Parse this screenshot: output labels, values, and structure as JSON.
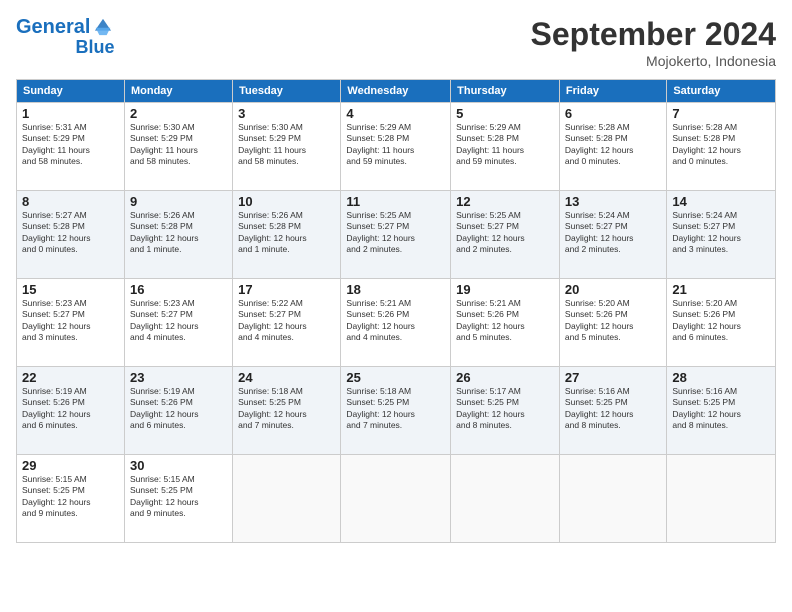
{
  "header": {
    "logo_line1": "General",
    "logo_line2": "Blue",
    "title": "September 2024",
    "location": "Mojokerto, Indonesia"
  },
  "weekdays": [
    "Sunday",
    "Monday",
    "Tuesday",
    "Wednesday",
    "Thursday",
    "Friday",
    "Saturday"
  ],
  "weeks": [
    [
      {
        "day": "1",
        "info": "Sunrise: 5:31 AM\nSunset: 5:29 PM\nDaylight: 11 hours\nand 58 minutes."
      },
      {
        "day": "2",
        "info": "Sunrise: 5:30 AM\nSunset: 5:29 PM\nDaylight: 11 hours\nand 58 minutes."
      },
      {
        "day": "3",
        "info": "Sunrise: 5:30 AM\nSunset: 5:29 PM\nDaylight: 11 hours\nand 58 minutes."
      },
      {
        "day": "4",
        "info": "Sunrise: 5:29 AM\nSunset: 5:28 PM\nDaylight: 11 hours\nand 59 minutes."
      },
      {
        "day": "5",
        "info": "Sunrise: 5:29 AM\nSunset: 5:28 PM\nDaylight: 11 hours\nand 59 minutes."
      },
      {
        "day": "6",
        "info": "Sunrise: 5:28 AM\nSunset: 5:28 PM\nDaylight: 12 hours\nand 0 minutes."
      },
      {
        "day": "7",
        "info": "Sunrise: 5:28 AM\nSunset: 5:28 PM\nDaylight: 12 hours\nand 0 minutes."
      }
    ],
    [
      {
        "day": "8",
        "info": "Sunrise: 5:27 AM\nSunset: 5:28 PM\nDaylight: 12 hours\nand 0 minutes."
      },
      {
        "day": "9",
        "info": "Sunrise: 5:26 AM\nSunset: 5:28 PM\nDaylight: 12 hours\nand 1 minute."
      },
      {
        "day": "10",
        "info": "Sunrise: 5:26 AM\nSunset: 5:28 PM\nDaylight: 12 hours\nand 1 minute."
      },
      {
        "day": "11",
        "info": "Sunrise: 5:25 AM\nSunset: 5:27 PM\nDaylight: 12 hours\nand 2 minutes."
      },
      {
        "day": "12",
        "info": "Sunrise: 5:25 AM\nSunset: 5:27 PM\nDaylight: 12 hours\nand 2 minutes."
      },
      {
        "day": "13",
        "info": "Sunrise: 5:24 AM\nSunset: 5:27 PM\nDaylight: 12 hours\nand 2 minutes."
      },
      {
        "day": "14",
        "info": "Sunrise: 5:24 AM\nSunset: 5:27 PM\nDaylight: 12 hours\nand 3 minutes."
      }
    ],
    [
      {
        "day": "15",
        "info": "Sunrise: 5:23 AM\nSunset: 5:27 PM\nDaylight: 12 hours\nand 3 minutes."
      },
      {
        "day": "16",
        "info": "Sunrise: 5:23 AM\nSunset: 5:27 PM\nDaylight: 12 hours\nand 4 minutes."
      },
      {
        "day": "17",
        "info": "Sunrise: 5:22 AM\nSunset: 5:27 PM\nDaylight: 12 hours\nand 4 minutes."
      },
      {
        "day": "18",
        "info": "Sunrise: 5:21 AM\nSunset: 5:26 PM\nDaylight: 12 hours\nand 4 minutes."
      },
      {
        "day": "19",
        "info": "Sunrise: 5:21 AM\nSunset: 5:26 PM\nDaylight: 12 hours\nand 5 minutes."
      },
      {
        "day": "20",
        "info": "Sunrise: 5:20 AM\nSunset: 5:26 PM\nDaylight: 12 hours\nand 5 minutes."
      },
      {
        "day": "21",
        "info": "Sunrise: 5:20 AM\nSunset: 5:26 PM\nDaylight: 12 hours\nand 6 minutes."
      }
    ],
    [
      {
        "day": "22",
        "info": "Sunrise: 5:19 AM\nSunset: 5:26 PM\nDaylight: 12 hours\nand 6 minutes."
      },
      {
        "day": "23",
        "info": "Sunrise: 5:19 AM\nSunset: 5:26 PM\nDaylight: 12 hours\nand 6 minutes."
      },
      {
        "day": "24",
        "info": "Sunrise: 5:18 AM\nSunset: 5:25 PM\nDaylight: 12 hours\nand 7 minutes."
      },
      {
        "day": "25",
        "info": "Sunrise: 5:18 AM\nSunset: 5:25 PM\nDaylight: 12 hours\nand 7 minutes."
      },
      {
        "day": "26",
        "info": "Sunrise: 5:17 AM\nSunset: 5:25 PM\nDaylight: 12 hours\nand 8 minutes."
      },
      {
        "day": "27",
        "info": "Sunrise: 5:16 AM\nSunset: 5:25 PM\nDaylight: 12 hours\nand 8 minutes."
      },
      {
        "day": "28",
        "info": "Sunrise: 5:16 AM\nSunset: 5:25 PM\nDaylight: 12 hours\nand 8 minutes."
      }
    ],
    [
      {
        "day": "29",
        "info": "Sunrise: 5:15 AM\nSunset: 5:25 PM\nDaylight: 12 hours\nand 9 minutes."
      },
      {
        "day": "30",
        "info": "Sunrise: 5:15 AM\nSunset: 5:25 PM\nDaylight: 12 hours\nand 9 minutes."
      },
      {
        "day": "",
        "info": ""
      },
      {
        "day": "",
        "info": ""
      },
      {
        "day": "",
        "info": ""
      },
      {
        "day": "",
        "info": ""
      },
      {
        "day": "",
        "info": ""
      }
    ]
  ]
}
